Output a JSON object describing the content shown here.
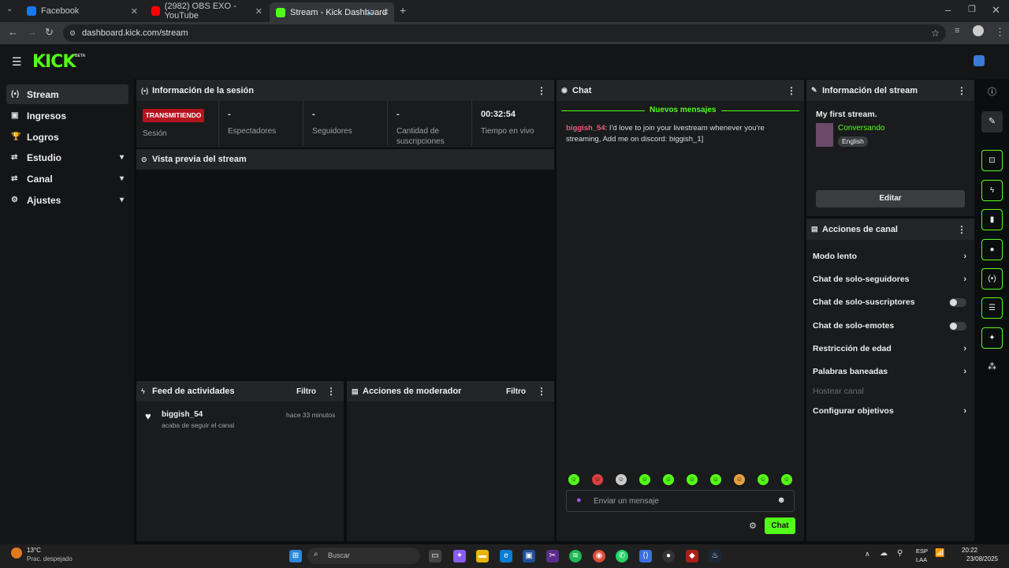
{
  "browser": {
    "tabs": [
      {
        "label": "Facebook",
        "color": "#1877f2"
      },
      {
        "label": "(2982) OBS EXO - YouTube",
        "color": "#ff0000"
      },
      {
        "label": "Stream - Kick Dashboard",
        "color": "#53fc18"
      }
    ],
    "url": "dashboard.kick.com/stream"
  },
  "header": {
    "logo": "KICK",
    "beta": "BETA"
  },
  "sidebar": {
    "items": [
      {
        "label": "Stream",
        "icon": "broadcast-icon"
      },
      {
        "label": "Ingresos",
        "icon": "money-icon"
      },
      {
        "label": "Logros",
        "icon": "trophy-icon"
      },
      {
        "label": "Estudio",
        "icon": "studio-icon"
      },
      {
        "label": "Canal",
        "icon": "channel-icon"
      },
      {
        "label": "Ajustes",
        "icon": "gear-icon"
      }
    ]
  },
  "session": {
    "title": "Información de la sesión",
    "badge": "TRANSMITIENDO",
    "badge_label": "Sesión",
    "stats": [
      {
        "value": "-",
        "label": "Espectadores"
      },
      {
        "value": "-",
        "label": "Seguidores"
      },
      {
        "value": "-",
        "label": "Cantidad de suscripciones"
      },
      {
        "value": "00:32:54",
        "label": "Tiempo en vivo"
      }
    ]
  },
  "preview": {
    "title": "Vista previa del stream"
  },
  "feed": {
    "title": "Feed de actividades",
    "filter": "Filtro",
    "items": [
      {
        "user": "biggish_54",
        "action": "acaba de seguir el canal",
        "time": "hace 33 minutos"
      }
    ]
  },
  "mod": {
    "title": "Acciones de moderador",
    "filter": "Filtro"
  },
  "chat": {
    "title": "Chat",
    "new_messages": "Nuevos mensajes",
    "messages": [
      {
        "user": "biggish_54",
        "text": ": I'd love to join your livestream whenever you're streaming, Add me on discord: biggish_1]"
      }
    ],
    "input_placeholder": "Enviar un mensaje",
    "send_label": "Chat"
  },
  "stream_info": {
    "title": "Información del stream",
    "stream_title": "My first stream.",
    "category": "Conversando",
    "language": "English",
    "edit_label": "Editar"
  },
  "channel_actions": {
    "title": "Acciones de canal",
    "items": [
      {
        "label": "Modo lento",
        "kind": "chevron"
      },
      {
        "label": "Chat de solo-seguidores",
        "kind": "chevron"
      },
      {
        "label": "Chat de solo-suscriptores",
        "kind": "toggle"
      },
      {
        "label": "Chat de solo-emotes",
        "kind": "toggle"
      },
      {
        "label": "Restricción de edad",
        "kind": "chevron"
      },
      {
        "label": "Palabras baneadas",
        "kind": "chevron"
      },
      {
        "label": "Hostear canal",
        "kind": "disabled"
      },
      {
        "label": "Configurar objetivos",
        "kind": "chevron"
      }
    ]
  },
  "taskbar": {
    "weather_temp": "13°C",
    "weather_desc": "Prac. despejado",
    "search": "Buscar",
    "lang": "ESP",
    "lang2": "LAA",
    "time": "20:22",
    "date": "23/08/2025"
  }
}
